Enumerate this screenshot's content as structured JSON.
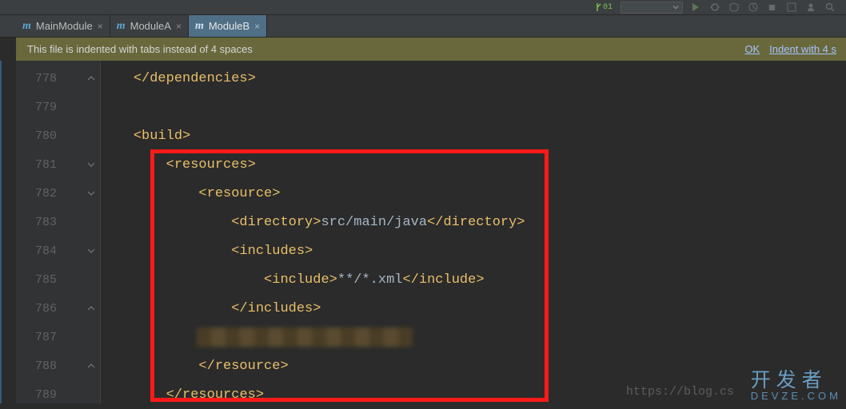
{
  "toolbar": {
    "badge": "01"
  },
  "tabs": [
    {
      "label": "MainModule",
      "active": false
    },
    {
      "label": "ModuleA",
      "active": false
    },
    {
      "label": "ModuleB",
      "active": true
    }
  ],
  "notification": {
    "message": "This file is indented with tabs instead of 4 spaces",
    "ok": "OK",
    "action": "Indent with 4 s"
  },
  "gutter": {
    "lines": [
      "778",
      "779",
      "780",
      "781",
      "782",
      "783",
      "784",
      "785",
      "786",
      "787",
      "788",
      "789"
    ],
    "fold": {
      "1": "close",
      "4": "open",
      "5": "open",
      "7": "open",
      "9": "close",
      "11": "close"
    }
  },
  "code": {
    "778": {
      "indent": "    ",
      "parts": [
        {
          "c": "t-tag",
          "t": "</dependencies>"
        }
      ]
    },
    "779": {
      "indent": "",
      "parts": []
    },
    "780": {
      "indent": "    ",
      "parts": [
        {
          "c": "t-tag",
          "t": "<build>"
        }
      ]
    },
    "781": {
      "indent": "        ",
      "parts": [
        {
          "c": "t-tag",
          "t": "<resources>"
        }
      ]
    },
    "782": {
      "indent": "            ",
      "parts": [
        {
          "c": "t-tag",
          "t": "<resource>"
        }
      ]
    },
    "783": {
      "indent": "                ",
      "parts": [
        {
          "c": "t-tag",
          "t": "<directory>"
        },
        {
          "c": "t-text",
          "t": "src/main/java"
        },
        {
          "c": "t-tag",
          "t": "</directory>"
        }
      ]
    },
    "784": {
      "indent": "                ",
      "parts": [
        {
          "c": "t-tag",
          "t": "<includes>"
        }
      ]
    },
    "785": {
      "indent": "                    ",
      "parts": [
        {
          "c": "t-tag",
          "t": "<include>"
        },
        {
          "c": "t-text",
          "t": "**/*.xml"
        },
        {
          "c": "t-tag",
          "t": "</include>"
        }
      ]
    },
    "786": {
      "indent": "                ",
      "parts": [
        {
          "c": "t-tag",
          "t": "</includes>"
        }
      ]
    },
    "787": {
      "blurred": true
    },
    "788": {
      "indent": "            ",
      "parts": [
        {
          "c": "t-tag",
          "t": "</resource>"
        }
      ]
    },
    "789": {
      "indent": "        ",
      "parts": [
        {
          "c": "t-tag",
          "t": "</resources>"
        }
      ]
    }
  },
  "watermark_logo": {
    "top": "开 发 者",
    "bottom": "DEVZE.COM"
  },
  "watermark_url": "https://blog.cs"
}
